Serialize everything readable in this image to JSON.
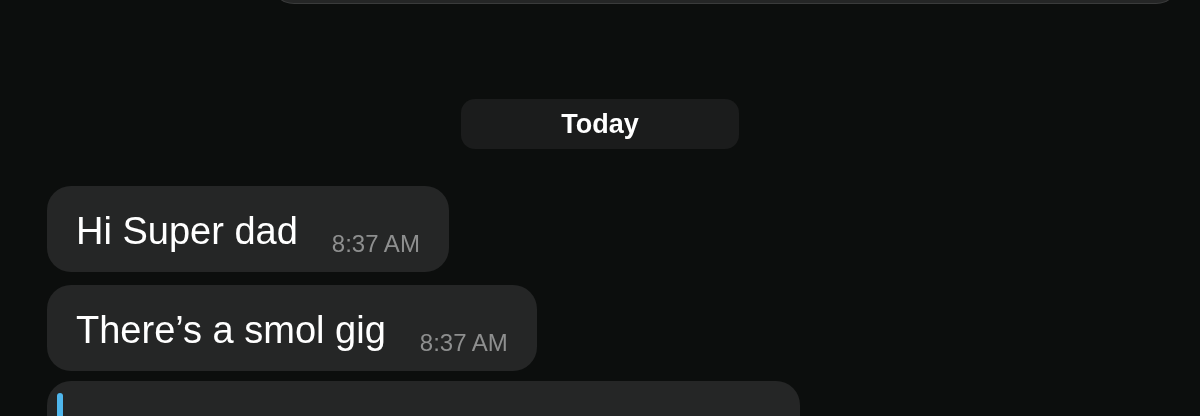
{
  "date_chip": {
    "label": "Today"
  },
  "messages": [
    {
      "text": "Hi Super dad",
      "time": "8:37 AM"
    },
    {
      "text": "There’s a smol gig",
      "time": "8:37 AM"
    }
  ]
}
